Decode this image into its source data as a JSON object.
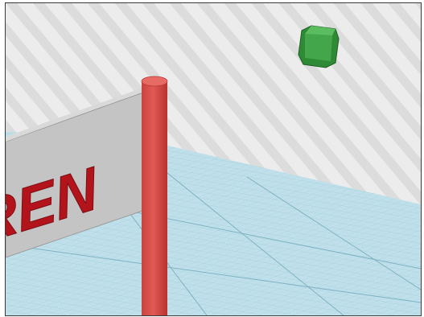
{
  "scene": {
    "sign_text": "REN",
    "colors": {
      "sign_text": "#b3141b",
      "post": "#d9534f",
      "cube": "#3d9a3d",
      "grid": "#9fc9d6",
      "background_stripes": "#d8d8d8"
    }
  }
}
